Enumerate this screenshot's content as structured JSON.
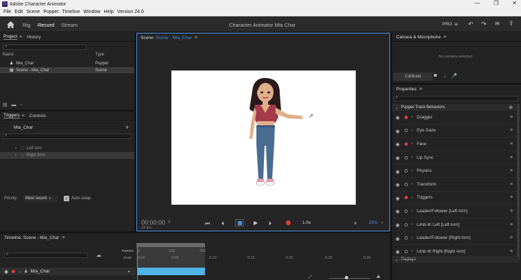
{
  "app": {
    "title": "Adobe Character Animator",
    "version": "Version 24.0"
  },
  "window_buttons": {
    "minimize": "—",
    "restore": "❐",
    "close": "✕"
  },
  "menu": [
    "File",
    "Edit",
    "Scene",
    "Puppet",
    "Timeline",
    "Window",
    "Help",
    "Version 24.0"
  ],
  "topbar": {
    "tabs": [
      "Rig",
      "Record",
      "Stream"
    ],
    "active_tab": "Record",
    "project_title": "Character Animator Mia Char",
    "pro_label": "PRO"
  },
  "project_panel": {
    "tabs": [
      "Project",
      "History"
    ],
    "col_name": "Name",
    "col_type": "Type",
    "items": [
      {
        "name": "Mia_Char",
        "type": "Puppet"
      },
      {
        "name": "Scene - Mia_Char",
        "type": "Scene"
      }
    ]
  },
  "triggers_panel": {
    "tabs": [
      "Triggers",
      "Controls"
    ],
    "puppet": "Mia_Char",
    "items": [
      "Left Arm",
      "Right Arm"
    ],
    "priority_label": "Priority",
    "priority_value": "Most recent",
    "autoswap_label": "Auto-swap",
    "autoswap_checked": true
  },
  "scene_panel": {
    "label": "Scene:",
    "scene_name": "Scene - Mia_Char",
    "timecode": "00:00:00",
    "timecode_suffix": "0",
    "fps": "24 fps",
    "speed": "1.0x",
    "zoom": "25%"
  },
  "camera_panel": {
    "title": "Camera & Microphone",
    "no_camera": "No camera selected",
    "calibrate": "Calibrate"
  },
  "properties_panel": {
    "title": "Properties",
    "section": "Puppet Track Behaviors",
    "behaviors": [
      {
        "name": "Dragger",
        "armed": true
      },
      {
        "name": "Eye Gaze",
        "armed": false
      },
      {
        "name": "Face",
        "armed": true
      },
      {
        "name": "Lip Sync",
        "armed": false
      },
      {
        "name": "Physics",
        "armed": false
      },
      {
        "name": "Transform",
        "armed": false
      },
      {
        "name": "Triggers",
        "armed": true
      },
      {
        "name": "Leader/Follower [Left Arm]",
        "armed": false
      },
      {
        "name": "Limb IK Left [Left Arm]",
        "armed": false
      },
      {
        "name": "Leader/Follower [Right Arm]",
        "armed": false
      },
      {
        "name": "Limb IK Right [Right Arm]",
        "armed": false
      }
    ],
    "replays": "Replays"
  },
  "timeline": {
    "title": "Timeline: Scene - Mia_Char",
    "frames_label": "frames",
    "mss_label": "m:ss",
    "frame_ticks": [
      "0",
      "100",
      "200"
    ],
    "time_ticks": [
      "0:00",
      "0:05",
      "0:10",
      "0:15",
      "0:20",
      "0:25",
      "0:30"
    ],
    "track_name": "Mia_Char"
  },
  "colors": {
    "accent": "#4a90e2",
    "record_red": "#e03c3c",
    "track_blue": "#4fb3e8",
    "panel_bg": "#232323"
  }
}
